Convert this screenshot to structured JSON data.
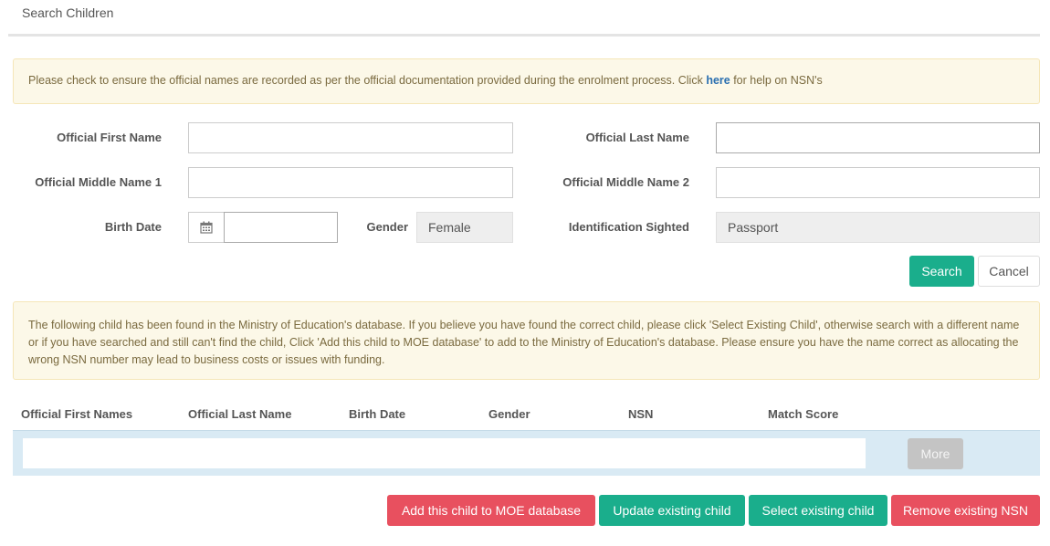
{
  "header": {
    "title": "Search Children"
  },
  "notice": {
    "text_before": "Please check to ensure the official names are recorded as per the official documentation provided during the enrolment process. Click ",
    "link": "here",
    "text_after": " for help on NSN's"
  },
  "form": {
    "first_name_label": "Official First Name",
    "first_name_value": "",
    "last_name_label": "Official Last Name",
    "last_name_value": "",
    "middle1_label": "Official Middle Name 1",
    "middle1_value": "",
    "middle2_label": "Official Middle Name 2",
    "middle2_value": "",
    "birth_date_label": "Birth Date",
    "birth_date_value": "",
    "gender_label": "Gender",
    "gender_value": "Female",
    "id_label": "Identification Sighted",
    "id_value": "Passport",
    "search_label": "Search",
    "cancel_label": "Cancel"
  },
  "result_notice": {
    "text": "The following child has been found in the Ministry of Education's database. If you believe you have found the correct child, please click 'Select Existing Child', otherwise search with a different name or if you have searched and still can't find the child, Click 'Add this child to MOE database' to add to the Ministry of Education's database. Please ensure you have the name correct as allocating the wrong NSN number may lead to business costs or issues with funding."
  },
  "table": {
    "columns": [
      "Official First Names",
      "Official Last Name",
      "Birth Date",
      "Gender",
      "NSN",
      "Match Score"
    ],
    "more_label": "More"
  },
  "actions": {
    "add_label": "Add this child to MOE database",
    "update_label": "Update existing child",
    "select_label": "Select existing child",
    "remove_label": "Remove existing NSN"
  },
  "icons": {
    "calendar": "calendar-icon"
  },
  "colors": {
    "green": "#1aae8c",
    "red": "#e8505f",
    "notice_bg": "#fcf8e8",
    "row_bg": "#d9eaf4"
  }
}
